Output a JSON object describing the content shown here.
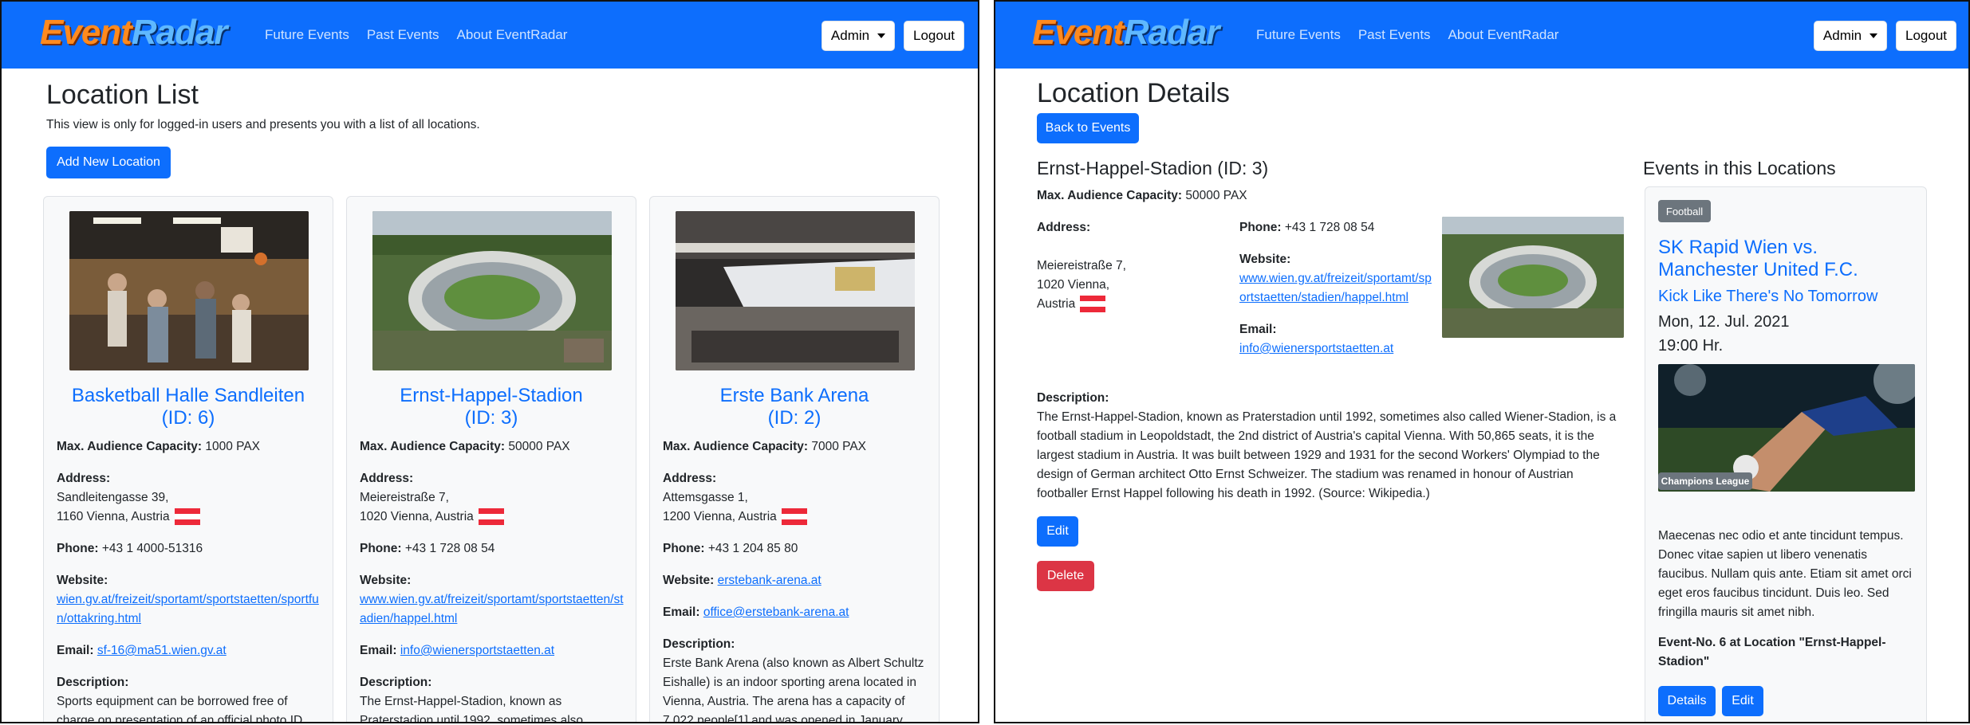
{
  "brand": {
    "logo_part1": "Event",
    "logo_part2": "Radar"
  },
  "nav": {
    "links": [
      "Future Events",
      "Past Events",
      "About EventRadar"
    ],
    "admin_label": "Admin",
    "logout_label": "Logout"
  },
  "left": {
    "title": "Location List",
    "intro": "This view is only for logged-in users and presents you with a list of all locations.",
    "add_button": "Add New Location",
    "labels": {
      "capacity": "Max. Audience Capacity:",
      "address": "Address:",
      "phone": "Phone:",
      "website": "Website:",
      "email": "Email:",
      "description": "Description:"
    },
    "cards": [
      {
        "name": "Basketball Halle Sandleiten",
        "id_label": "(ID: 6)",
        "capacity": "1000 PAX",
        "address1": "Sandleitengasse 39,",
        "address2": "1160 Vienna, Austria",
        "phone": "+43 1 4000-51316",
        "website": "wien.gv.at/freizeit/sportamt/sportstaetten/sportfun/ottakring.html",
        "email": "sf-16@ma51.wien.gv.at",
        "description": "Sports equipment can be borrowed free of charge on presentation of an official photo ID."
      },
      {
        "name": "Ernst-Happel-Stadion",
        "id_label": "(ID: 3)",
        "capacity": "50000 PAX",
        "address1": "Meiereistraße 7,",
        "address2": "1020 Vienna, Austria",
        "phone": "+43 1 728 08 54",
        "website": "www.wien.gv.at/freizeit/sportamt/sportstaetten/stadien/happel.html",
        "email": "info@wienersportstaetten.at",
        "description": "The Ernst-Happel-Stadion, known as Praterstadion until 1992, sometimes also"
      },
      {
        "name": "Erste Bank Arena",
        "id_label": "(ID: 2)",
        "capacity": "7000 PAX",
        "address1": "Attemsgasse 1,",
        "address2": "1200 Vienna, Austria",
        "phone": "+43 1 204 85 80",
        "website": "erstebank-arena.at",
        "email": "office@erstebank-arena.at",
        "description": "Erste Bank Arena (also known as Albert Schultz Eishalle) is an indoor sporting arena located in Vienna, Austria. The arena has a capacity of 7,022 people[1] and was opened in January"
      }
    ]
  },
  "right": {
    "title": "Location Details",
    "back_button": "Back to Events",
    "location_heading": "Ernst-Happel-Stadion (ID: 3)",
    "capacity_label": "Max. Audience Capacity:",
    "capacity": "50000 PAX",
    "address_label": "Address:",
    "address1": "Meiereistraße 7,",
    "address2": "1020 Vienna,",
    "address3": "Austria",
    "phone_label": "Phone:",
    "phone": "+43 1 728 08 54",
    "website_label": "Website:",
    "website": "www.wien.gv.at/freizeit/sportamt/sportstaetten/stadien/happel.html",
    "email_label": "Email:",
    "email": "info@wienersportstaetten.at",
    "description_label": "Description:",
    "description": "The Ernst-Happel-Stadion, known as Praterstadion until 1992, sometimes also called Wiener-Stadion, is a football stadium in Leopoldstadt, the 2nd district of Austria's capital Vienna. With 50,865 seats, it is the largest stadium in Austria. It was built between 1929 and 1931 for the second Workers' Olympiad to the design of German architect Otto Ernst Schweizer. The stadium was renamed in honour of Austrian footballer Ernst Happel following his death in 1992. (Source: Wikipedia.)",
    "edit_button": "Edit",
    "delete_button": "Delete",
    "events_heading": "Events in this Locations",
    "event": {
      "category": "Football",
      "title": "SK Rapid Wien vs. Manchester United F.C.",
      "subtitle": "Kick Like There's No Tomorrow",
      "date": "Mon, 12. Jul. 2021",
      "time": "19:00 Hr.",
      "image_badge": "Champions League",
      "text": "Maecenas nec odio et ante tincidunt tempus. Donec vitae sapien ut libero venenatis faucibus. Nullam quis ante. Etiam sit amet orci eget eros faucibus tincidunt. Duis leo. Sed fringilla mauris sit amet nibh.",
      "event_no": "Event-No. 6 at Location \"Ernst-Happel-Stadion\"",
      "details_button": "Details",
      "edit_button": "Edit"
    }
  },
  "colors": {
    "navbar": "#0d6efd",
    "primary": "#0d6efd",
    "danger": "#dc3545",
    "badge": "#6c757d",
    "card_bg": "#f8f9fa"
  }
}
